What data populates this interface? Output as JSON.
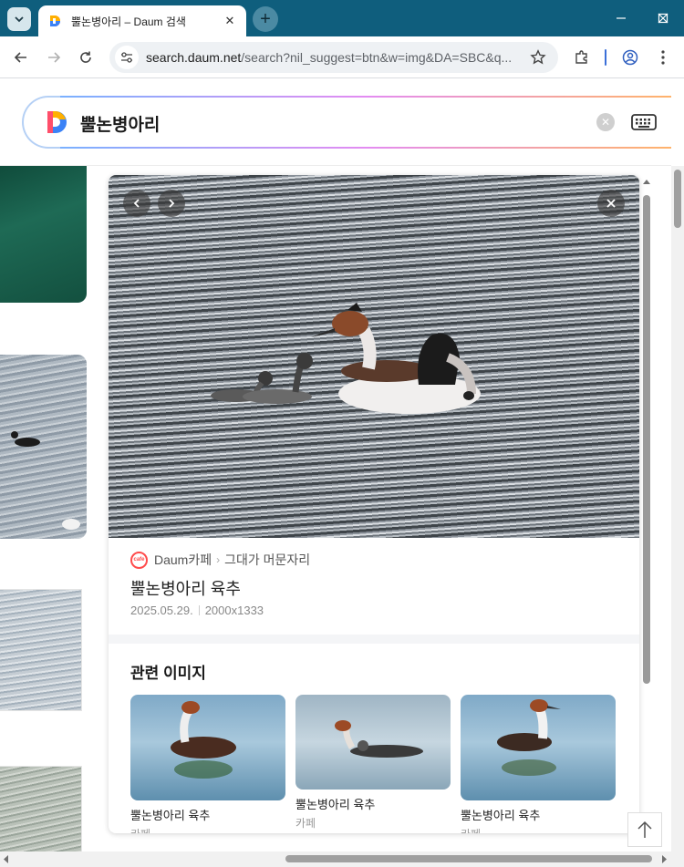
{
  "browser": {
    "tab_title": "뿔논병아리 – Daum 검색",
    "url_host": "search.daum.net",
    "url_path": "/search?nil_suggest=btn&w=img&DA=SBC&q..."
  },
  "search": {
    "query": "뿔논병아리"
  },
  "detail": {
    "source_site": "Daum카페",
    "source_name": "그대가 머문자리",
    "cafe_badge": "cafe",
    "title": "뿔논병아리 육추",
    "date": "2025.05.29.",
    "dimensions": "2000x1333"
  },
  "related": {
    "heading": "관련 이미지",
    "items": [
      {
        "label": "뿔논병아리 육추",
        "source": "카페"
      },
      {
        "label": "뿔논병아리 육추",
        "source": "카페"
      },
      {
        "label": "뿔논병아리 육추",
        "source": "카페"
      }
    ]
  },
  "colors": {
    "titlebar": "#0f5e7d",
    "accent_blue": "#b5d0f5",
    "cafe_red": "#ff4b4b"
  }
}
